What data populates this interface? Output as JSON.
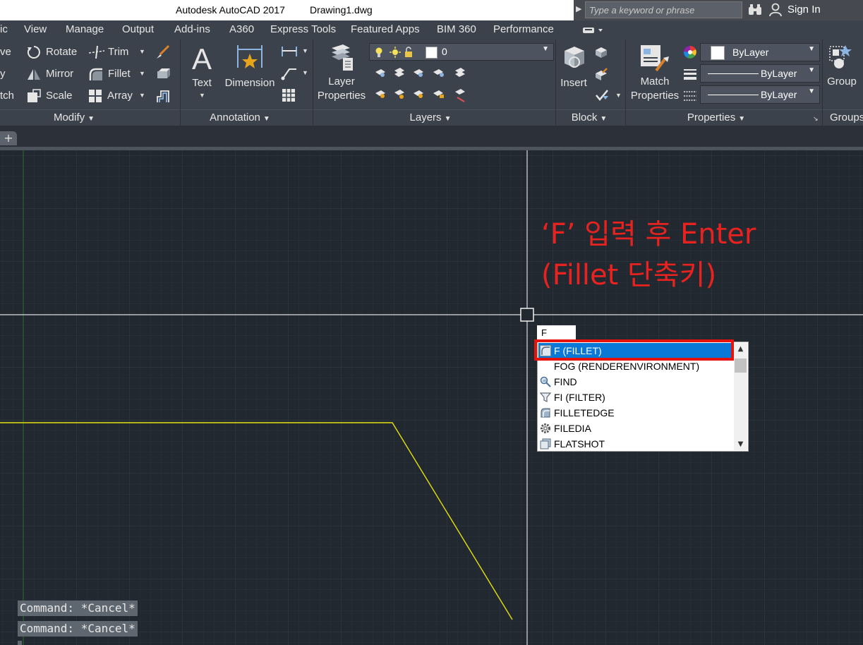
{
  "titlebar": {
    "app_title": "Autodesk AutoCAD 2017",
    "document_title": "Drawing1.dwg",
    "search_placeholder": "Type a keyword or phrase",
    "sign_in": "Sign In"
  },
  "menu": {
    "tabs": [
      "ic",
      "View",
      "Manage",
      "Output",
      "Add-ins",
      "A360",
      "Express Tools",
      "Featured Apps",
      "BIM 360",
      "Performance"
    ]
  },
  "ribbon": {
    "modify": {
      "title": "Modify",
      "tools": [
        "ve",
        "y",
        "tch",
        "Rotate",
        "Mirror",
        "Scale",
        "Trim",
        "Fillet",
        "Array"
      ]
    },
    "annotation": {
      "title": "Annotation",
      "text_label": "Text",
      "dimension_label": "Dimension"
    },
    "layers": {
      "title": "Layers",
      "layer_properties_line1": "Layer",
      "layer_properties_line2": "Properties",
      "current_layer": "0"
    },
    "block": {
      "title": "Block",
      "insert_label": "Insert"
    },
    "properties": {
      "title": "Properties",
      "match_line1": "Match",
      "match_line2": "Properties",
      "color": "ByLayer",
      "linetype": "ByLayer",
      "lineweight": "ByLayer"
    },
    "groups": {
      "title": "Groups",
      "group_label": "Group"
    }
  },
  "annotation_overlay": {
    "line1": "‘F’ 입력 후 Enter",
    "line2": "(Fillet 단축키)",
    "color": "#e8231f"
  },
  "command": {
    "input_value": "F",
    "suggestions": [
      {
        "label": "F (FILLET)",
        "icon": "fillet-icon",
        "selected": true
      },
      {
        "label": "FOG (RENDERENVIRONMENT)",
        "icon": "none",
        "selected": false
      },
      {
        "label": "FIND",
        "icon": "find-icon",
        "selected": false
      },
      {
        "label": "FI (FILTER)",
        "icon": "filter-icon",
        "selected": false
      },
      {
        "label": "FILLETEDGE",
        "icon": "filletedge-icon",
        "selected": false
      },
      {
        "label": "FILEDIA",
        "icon": "gear-icon",
        "selected": false
      },
      {
        "label": "FLATSHOT",
        "icon": "flatshot-icon",
        "selected": false
      }
    ],
    "history": [
      "Command: *Cancel*",
      "Command: *Cancel*"
    ]
  },
  "colors": {
    "canvas_bg": "#212830",
    "ribbon_bg": "#3c424c",
    "selection_blue": "#0a78d7",
    "highlight_red": "#e8120c",
    "polyline_yellow": "#e4e10c"
  }
}
